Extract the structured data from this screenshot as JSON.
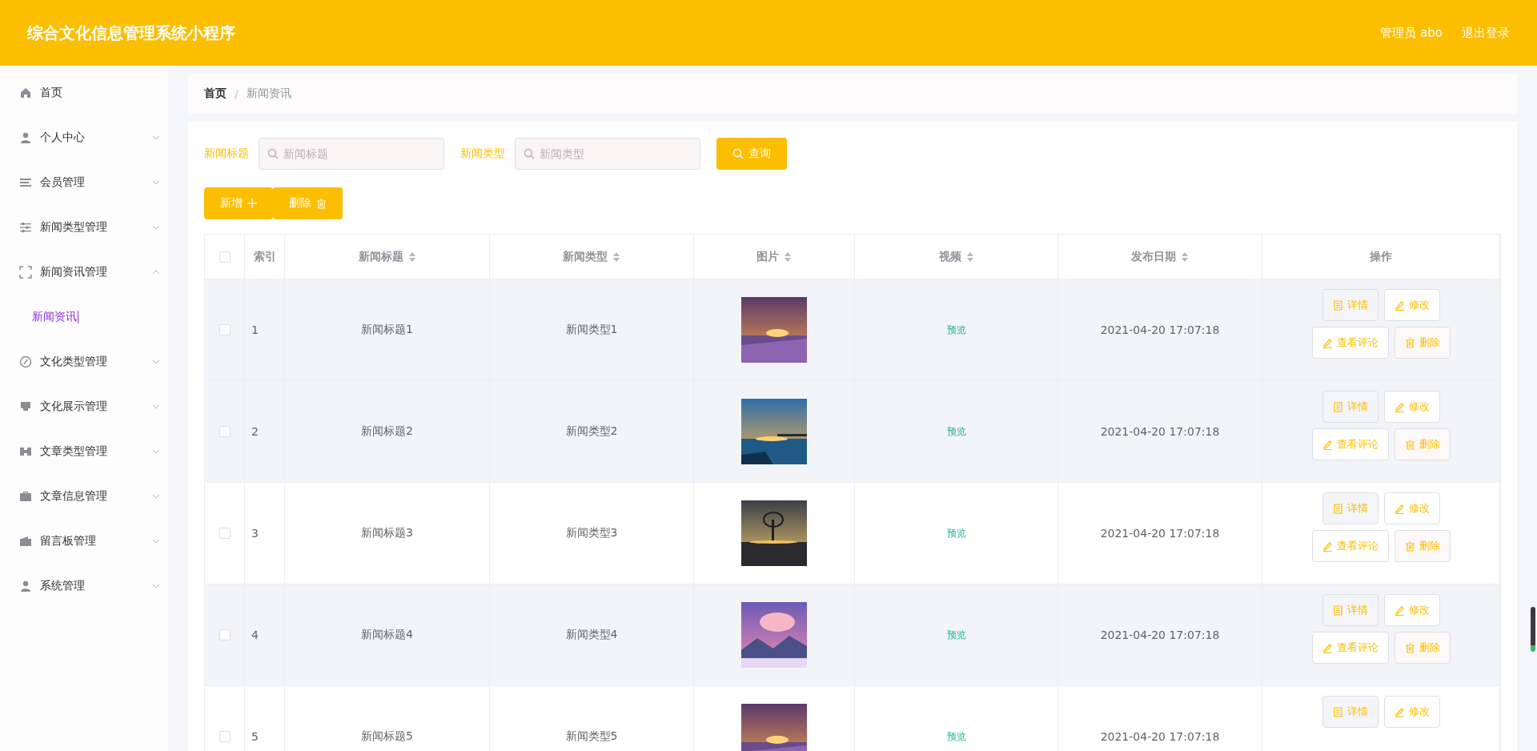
{
  "header": {
    "title": "综合文化信息管理系统小程序",
    "user": "管理员 abo",
    "logout": "退出登录"
  },
  "sidebar": {
    "items": [
      {
        "label": "首页",
        "kind": "link"
      },
      {
        "label": "个人中心",
        "kind": "group",
        "expanded": false
      },
      {
        "label": "会员管理",
        "kind": "group",
        "expanded": false
      },
      {
        "label": "新闻类型管理",
        "kind": "group",
        "expanded": false
      },
      {
        "label": "新闻资讯管理",
        "kind": "group",
        "expanded": true,
        "children": [
          {
            "label": "新闻资讯",
            "selected": true
          }
        ]
      },
      {
        "label": "文化类型管理",
        "kind": "group",
        "expanded": false
      },
      {
        "label": "文化展示管理",
        "kind": "group",
        "expanded": false
      },
      {
        "label": "文章类型管理",
        "kind": "group",
        "expanded": false
      },
      {
        "label": "文章信息管理",
        "kind": "group",
        "expanded": false
      },
      {
        "label": "留言板管理",
        "kind": "group",
        "expanded": false
      },
      {
        "label": "系统管理",
        "kind": "group",
        "expanded": false
      }
    ]
  },
  "breadcrumb": {
    "items": [
      "首页",
      "新闻资讯"
    ],
    "separator": "/"
  },
  "search": {
    "fields": [
      {
        "label": "新闻标题",
        "placeholder": "新闻标题"
      },
      {
        "label": "新闻类型",
        "placeholder": "新闻类型"
      }
    ],
    "button": "查询"
  },
  "toolbar": [
    {
      "label": "新增",
      "kind": "add"
    },
    {
      "label": "删除",
      "kind": "delete"
    }
  ],
  "table": {
    "all_checked": false,
    "columns": [
      {
        "label": "索引",
        "sortable": false
      },
      {
        "label": "新闻标题",
        "sortable": true
      },
      {
        "label": "新闻类型",
        "sortable": true
      },
      {
        "label": "图片",
        "sortable": true
      },
      {
        "label": "视频",
        "sortable": true
      },
      {
        "label": "发布日期",
        "sortable": true
      },
      {
        "label": "操作",
        "sortable": false
      }
    ],
    "rows": [
      {
        "index": "1",
        "title": "新闻标题1",
        "type": "新闻类型1",
        "video": "预览",
        "date": "2021-04-20 17:07:18",
        "checked": false,
        "shaded": true,
        "actions": [
          {
            "label": "详情",
            "kind": "detail"
          },
          {
            "label": "修改",
            "kind": "edit"
          },
          {
            "label": "查看评论",
            "kind": "comments"
          },
          {
            "label": "删除",
            "kind": "delete"
          }
        ]
      },
      {
        "index": "2",
        "title": "新闻标题2",
        "type": "新闻类型2",
        "video": "预览",
        "date": "2021-04-20 17:07:18",
        "checked": false,
        "shaded": true,
        "actions": [
          {
            "label": "详情",
            "kind": "detail"
          },
          {
            "label": "修改",
            "kind": "edit"
          },
          {
            "label": "查看评论",
            "kind": "comments"
          },
          {
            "label": "删除",
            "kind": "delete"
          }
        ]
      },
      {
        "index": "3",
        "title": "新闻标题3",
        "type": "新闻类型3",
        "video": "预览",
        "date": "2021-04-20 17:07:18",
        "checked": false,
        "shaded": false,
        "actions": [
          {
            "label": "详情",
            "kind": "detail"
          },
          {
            "label": "修改",
            "kind": "edit"
          },
          {
            "label": "查看评论",
            "kind": "comments"
          },
          {
            "label": "删除",
            "kind": "delete"
          }
        ]
      },
      {
        "index": "4",
        "title": "新闻标题4",
        "type": "新闻类型4",
        "video": "预览",
        "date": "2021-04-20 17:07:18",
        "checked": false,
        "shaded": true,
        "actions": [
          {
            "label": "详情",
            "kind": "detail"
          },
          {
            "label": "修改",
            "kind": "edit"
          },
          {
            "label": "查看评论",
            "kind": "comments"
          },
          {
            "label": "删除",
            "kind": "delete"
          }
        ]
      },
      {
        "index": "5",
        "title": "新闻标题5",
        "type": "新闻类型5",
        "video": "预览",
        "date": "2021-04-20 17:07:18",
        "checked": false,
        "shaded": false,
        "actions": [
          {
            "label": "详情",
            "kind": "detail"
          },
          {
            "label": "修改",
            "kind": "edit"
          }
        ]
      }
    ]
  }
}
